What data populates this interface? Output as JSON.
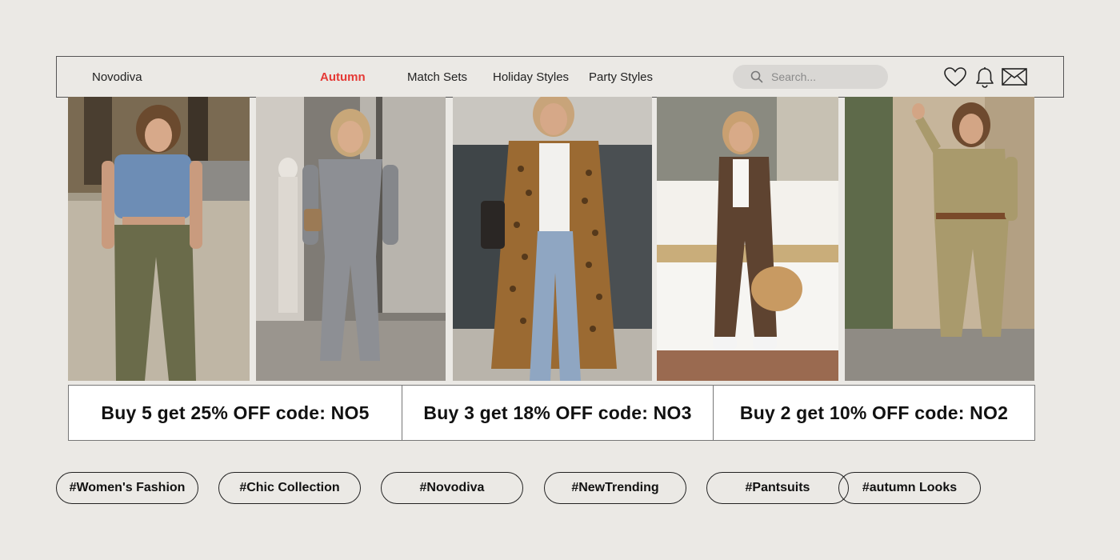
{
  "navbar": {
    "brand": "Novodiva",
    "links": [
      {
        "label": "Autumn",
        "active": true
      },
      {
        "label": "Match Sets",
        "active": false
      },
      {
        "label": "Holiday Styles",
        "active": false
      },
      {
        "label": "Party Styles",
        "active": false
      }
    ],
    "search": {
      "placeholder": "Search...",
      "icon": "search-icon"
    },
    "icons": [
      "heart-icon",
      "bell-icon",
      "mail-icon"
    ]
  },
  "photos": [
    {
      "subject": "woman in denim vest and olive cargo pants"
    },
    {
      "subject": "woman in grey denim jumpsuit"
    },
    {
      "subject": "woman in leopard print long coat and jeans"
    },
    {
      "subject": "woman in leopard print suit with straw bag"
    },
    {
      "subject": "woman in khaki utility jumpsuit"
    }
  ],
  "promos": [
    "Buy 5 get 25% OFF code: NO5",
    "Buy 3 get 18% OFF code: NO3",
    "Buy 2 get 10% OFF code: NO2"
  ],
  "hashtags": [
    "#Women's Fashion",
    "#Chic Collection",
    "#Novodiva",
    "#NewTrending",
    "#Pantsuits",
    "#autumn Looks"
  ],
  "colors": {
    "background": "#ebe9e5",
    "accent": "#e53935",
    "search_bg": "#d9d7d4"
  }
}
